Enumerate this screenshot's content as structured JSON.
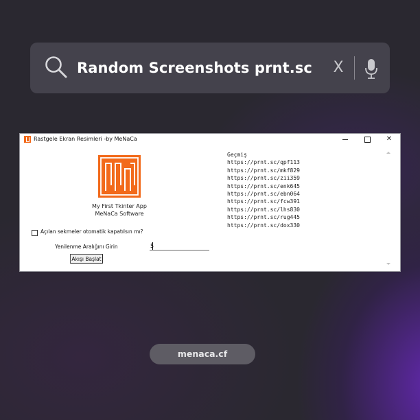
{
  "search": {
    "query": "Random Screenshots prnt.sc",
    "clear_label": "X"
  },
  "app_window": {
    "title": "Rastgele Ekran Resimleri -by MeNaCa",
    "caption_line1": "My First Tkinter App",
    "caption_line2": "MeNaCa Software",
    "checkbox_label": "Açılan sekmeler otomatik kapatılsın mı?",
    "checkbox_checked": false,
    "interval_label": "Yenilenme Aralığını Girin",
    "interval_value": "5",
    "start_button_label": "Akışı Başlat",
    "history_title": "Geçmiş",
    "history": [
      "https://prnt.sc/qpf113",
      "https://prnt.sc/mkf829",
      "https://prnt.sc/zii359",
      "https://prnt.sc/enk645",
      "https://prnt.sc/ebn064",
      "https://prnt.sc/fcw391",
      "https://prnt.sc/lhs830",
      "https://prnt.sc/rug445",
      "https://prnt.sc/dox330"
    ],
    "logo_color": "#f26a1b"
  },
  "footer": {
    "site_label": "menaca.cf"
  }
}
